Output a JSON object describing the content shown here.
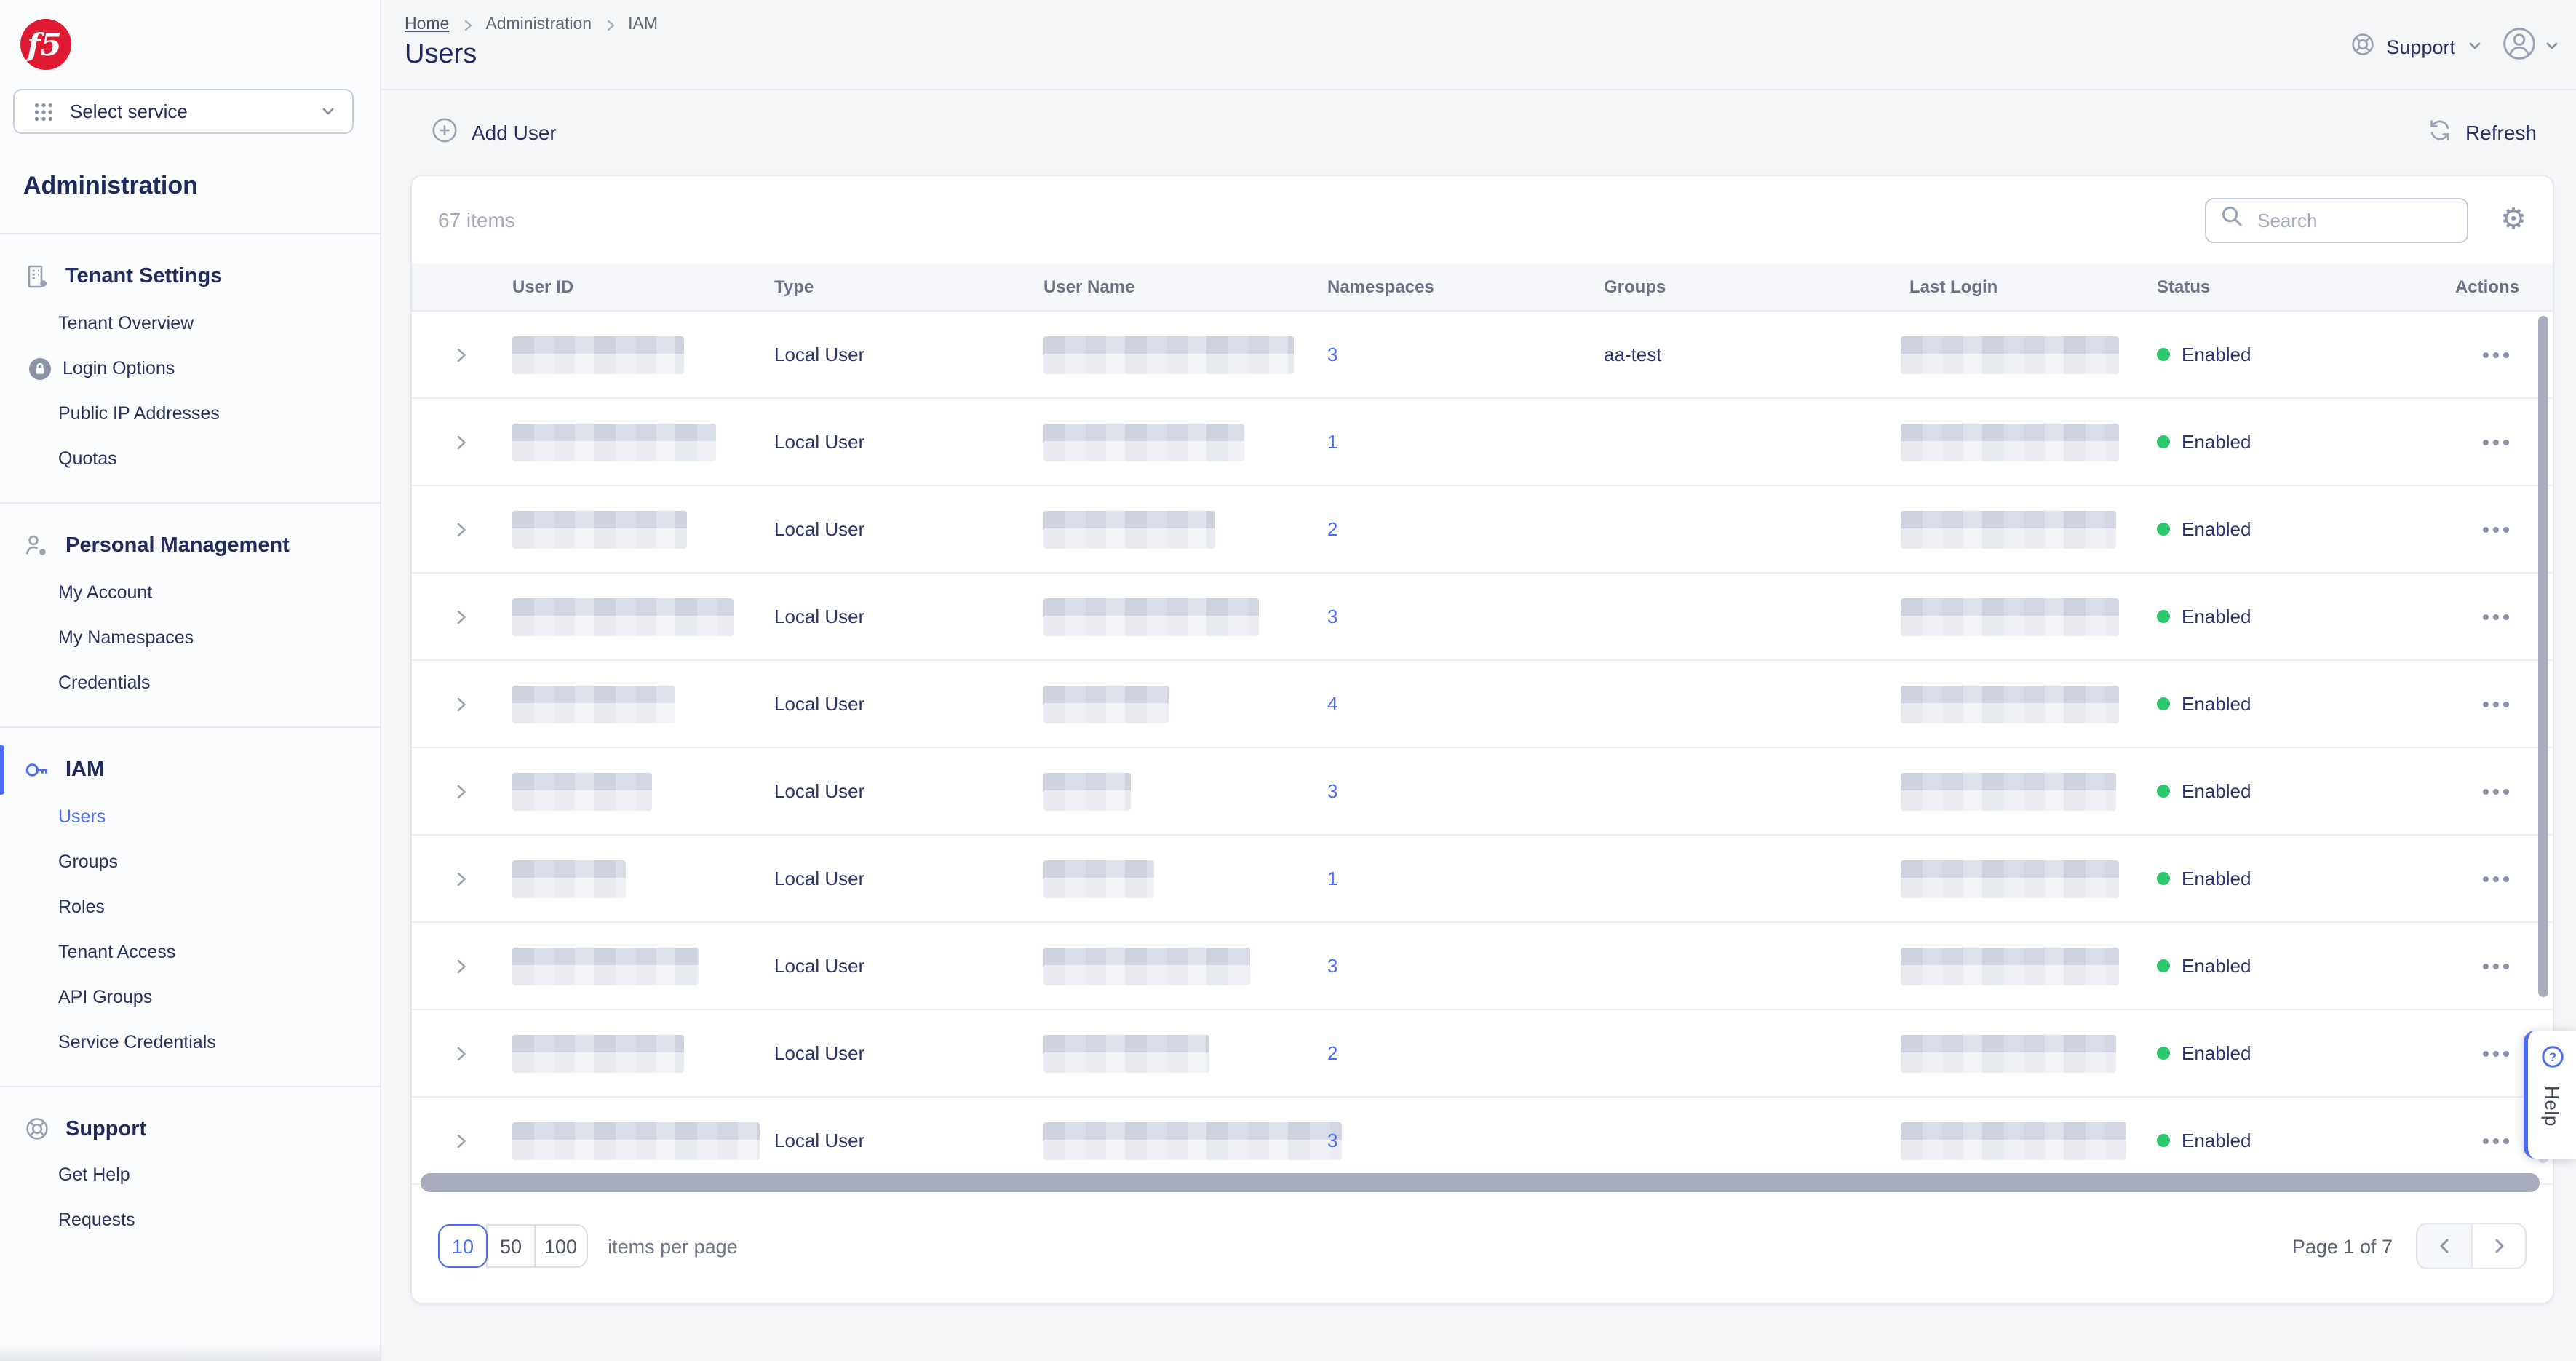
{
  "brand": {
    "logo_text": "f5"
  },
  "service_selector": {
    "label": "Select service"
  },
  "sidebar": {
    "title": "Administration",
    "sections": [
      {
        "id": "tenant-settings",
        "label": "Tenant Settings",
        "icon": "building-gear-icon",
        "active": false,
        "items": [
          {
            "label": "Tenant Overview"
          },
          {
            "label": "Login Options",
            "badge": "lock-icon"
          },
          {
            "label": "Public IP Addresses"
          },
          {
            "label": "Quotas"
          }
        ]
      },
      {
        "id": "personal-management",
        "label": "Personal Management",
        "icon": "person-gear-icon",
        "active": false,
        "items": [
          {
            "label": "My Account"
          },
          {
            "label": "My Namespaces"
          },
          {
            "label": "Credentials"
          }
        ]
      },
      {
        "id": "iam",
        "label": "IAM",
        "icon": "key-icon",
        "active": true,
        "items": [
          {
            "label": "Users",
            "active": true
          },
          {
            "label": "Groups"
          },
          {
            "label": "Roles"
          },
          {
            "label": "Tenant Access"
          },
          {
            "label": "API Groups"
          },
          {
            "label": "Service Credentials"
          }
        ]
      },
      {
        "id": "support",
        "label": "Support",
        "icon": "lifebuoy-icon",
        "active": false,
        "items": [
          {
            "label": "Get Help"
          },
          {
            "label": "Requests"
          }
        ]
      }
    ]
  },
  "header": {
    "breadcrumb": [
      {
        "label": "Home",
        "link": true
      },
      {
        "label": "Administration"
      },
      {
        "label": "IAM"
      }
    ],
    "title": "Users",
    "support_label": "Support"
  },
  "toolbar": {
    "add_user_label": "Add User",
    "refresh_label": "Refresh"
  },
  "table": {
    "items_count": "67 items",
    "search_placeholder": "Search",
    "columns": [
      "User ID",
      "Type",
      "User Name",
      "Namespaces",
      "Groups",
      "Last Login",
      "Status",
      "Actions"
    ],
    "rows": [
      {
        "type": "Local User",
        "namespaces": "3",
        "groups": "aa-test",
        "status": "Enabled",
        "id_w": 118,
        "name_w": 172,
        "login_w": 150
      },
      {
        "type": "Local User",
        "namespaces": "1",
        "groups": "",
        "status": "Enabled",
        "id_w": 140,
        "name_w": 138,
        "login_w": 150
      },
      {
        "type": "Local User",
        "namespaces": "2",
        "groups": "",
        "status": "Enabled",
        "id_w": 120,
        "name_w": 118,
        "login_w": 148
      },
      {
        "type": "Local User",
        "namespaces": "3",
        "groups": "",
        "status": "Enabled",
        "id_w": 152,
        "name_w": 148,
        "login_w": 150
      },
      {
        "type": "Local User",
        "namespaces": "4",
        "groups": "",
        "status": "Enabled",
        "id_w": 112,
        "name_w": 86,
        "login_w": 150
      },
      {
        "type": "Local User",
        "namespaces": "3",
        "groups": "",
        "status": "Enabled",
        "id_w": 96,
        "name_w": 60,
        "login_w": 148
      },
      {
        "type": "Local User",
        "namespaces": "1",
        "groups": "",
        "status": "Enabled",
        "id_w": 78,
        "name_w": 76,
        "login_w": 150
      },
      {
        "type": "Local User",
        "namespaces": "3",
        "groups": "",
        "status": "Enabled",
        "id_w": 128,
        "name_w": 142,
        "login_w": 150
      },
      {
        "type": "Local User",
        "namespaces": "2",
        "groups": "",
        "status": "Enabled",
        "id_w": 118,
        "name_w": 114,
        "login_w": 148
      },
      {
        "type": "Local User",
        "namespaces": "3",
        "groups": "",
        "status": "Enabled",
        "id_w": 170,
        "name_w": 205,
        "login_w": 155
      }
    ]
  },
  "pagination": {
    "page_sizes": [
      "10",
      "50",
      "100"
    ],
    "selected_page_size": "10",
    "items_per_page_label": "items per page",
    "page_label": "Page 1 of 7"
  },
  "help": {
    "label": "Help"
  },
  "colors": {
    "accent": "#4c6cf5",
    "navy": "#232f5e",
    "success_green": "#2bc56a",
    "brand_red": "#e01933"
  }
}
